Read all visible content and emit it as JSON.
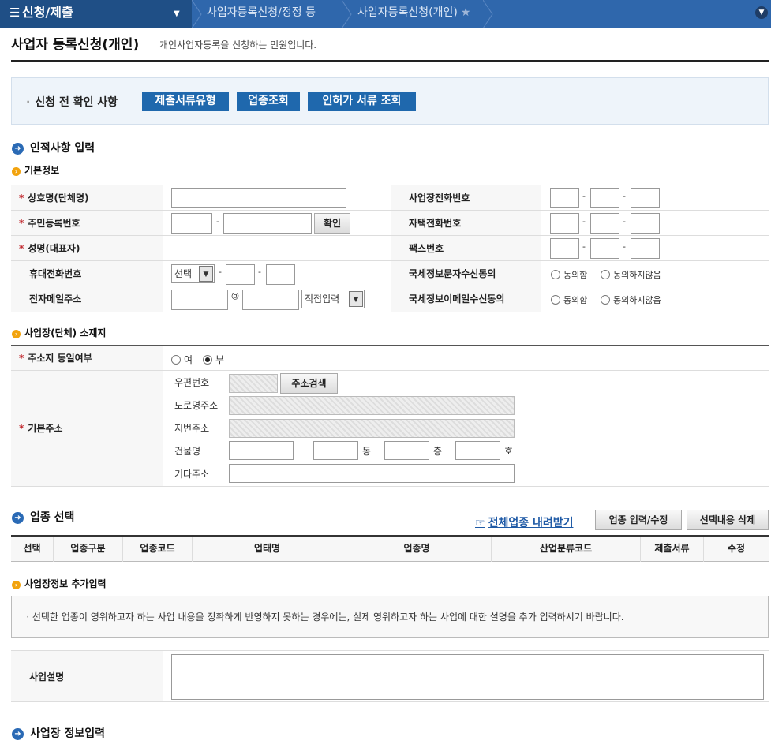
{
  "nav": {
    "menu": "신청/제출",
    "crumb1": "사업자등록신청/정정 등",
    "crumb2": "사업자등록신청(개인)"
  },
  "page": {
    "title": "사업자 등록신청(개인)",
    "desc": "개인사업자등록을 신청하는 민원입니다."
  },
  "precheck": {
    "label": "신청 전 확인 사항",
    "btn1": "제출서류유형",
    "btn2": "업종조회",
    "btn3": "인허가 서류 조회"
  },
  "personal": {
    "heading": "인적사항 입력",
    "sub": "기본정보",
    "company_name": "상호명(단체명)",
    "resident_no": "주민등록번호",
    "confirm_btn": "확인",
    "name": "성명(대표자)",
    "mobile": "휴대전화번호",
    "mobile_select": "선택",
    "email": "전자메일주소",
    "email_select": "직접입력",
    "at": "@",
    "biz_phone": "사업장전화번호",
    "home_phone": "자택전화번호",
    "fax": "팩스번호",
    "sms_consent": "국세정보문자수신동의",
    "email_consent": "국세정보이메일수신동의",
    "agree": "동의함",
    "disagree": "동의하지않음"
  },
  "location": {
    "sub": "사업장(단체) 소재지",
    "same_addr": "주소지 동일여부",
    "yes": "여",
    "no": "부",
    "base_addr": "기본주소",
    "zip": "우편번호",
    "search_btn": "주소검색",
    "road": "도로명주소",
    "lot": "지번주소",
    "building": "건물명",
    "dong": "동",
    "floor": "층",
    "ho": "호",
    "etc": "기타주소"
  },
  "industry": {
    "heading": "업종 선택",
    "download": "전체업종 내려받기",
    "edit_btn": "업종 입력/수정",
    "delete_btn": "선택내용 삭제",
    "columns": [
      "선택",
      "업종구분",
      "업종코드",
      "업태명",
      "업종명",
      "산업분류코드",
      "제출서류",
      "수정"
    ]
  },
  "extra": {
    "sub": "사업장정보 추가입력",
    "notice": "선택한 업종이 영위하고자 하는 사업 내용을 정확하게 반영하지 못하는 경우에는, 실제 영위하고자 하는 사업에 대한 설명을 추가 입력하시기 바랍니다.",
    "desc_label": "사업설명"
  },
  "biz_info": {
    "heading": "사업장 정보입력"
  },
  "colors": {
    "nav": "#2f67ac",
    "nav_dark": "#1f4f86",
    "button": "#1f68ad",
    "required": "#c0262c",
    "bullet_orange": "#f2a30e"
  },
  "icons": {
    "menu": "hamburger-icon",
    "crumb_dropdown": "chevron-down-icon",
    "favorite": "star-icon",
    "expand": "circle-chevron-down-icon",
    "download": "hand-pointer-icon"
  }
}
